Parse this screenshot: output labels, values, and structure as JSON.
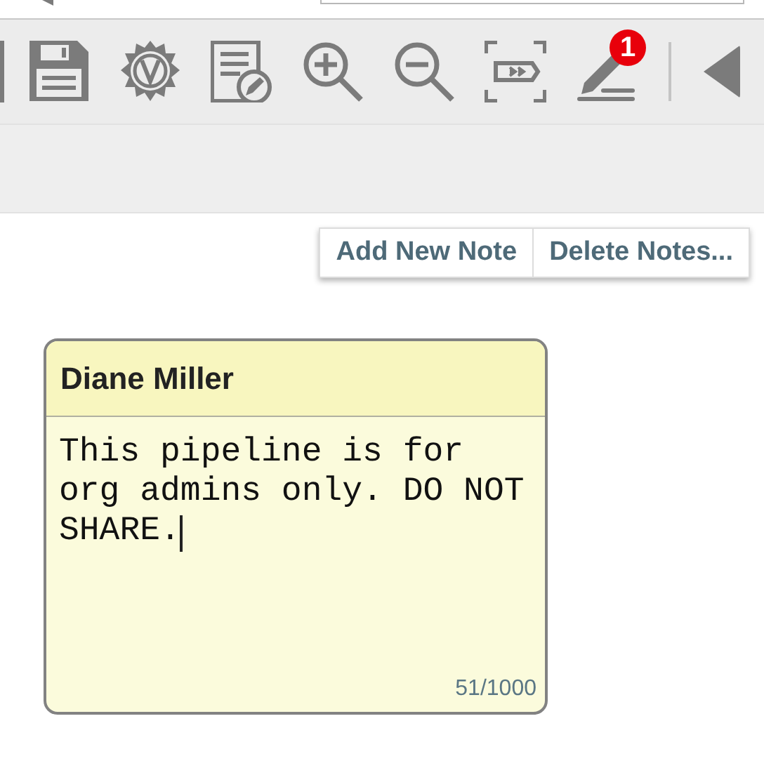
{
  "toolbar": {
    "notes_badge": "1"
  },
  "note_actions": [
    "Add New Note",
    "Delete Notes..."
  ],
  "note": {
    "author": "Diane Miller",
    "text": "This pipeline is for org admins only. DO NOT SHARE.",
    "counter": "51/1000"
  }
}
